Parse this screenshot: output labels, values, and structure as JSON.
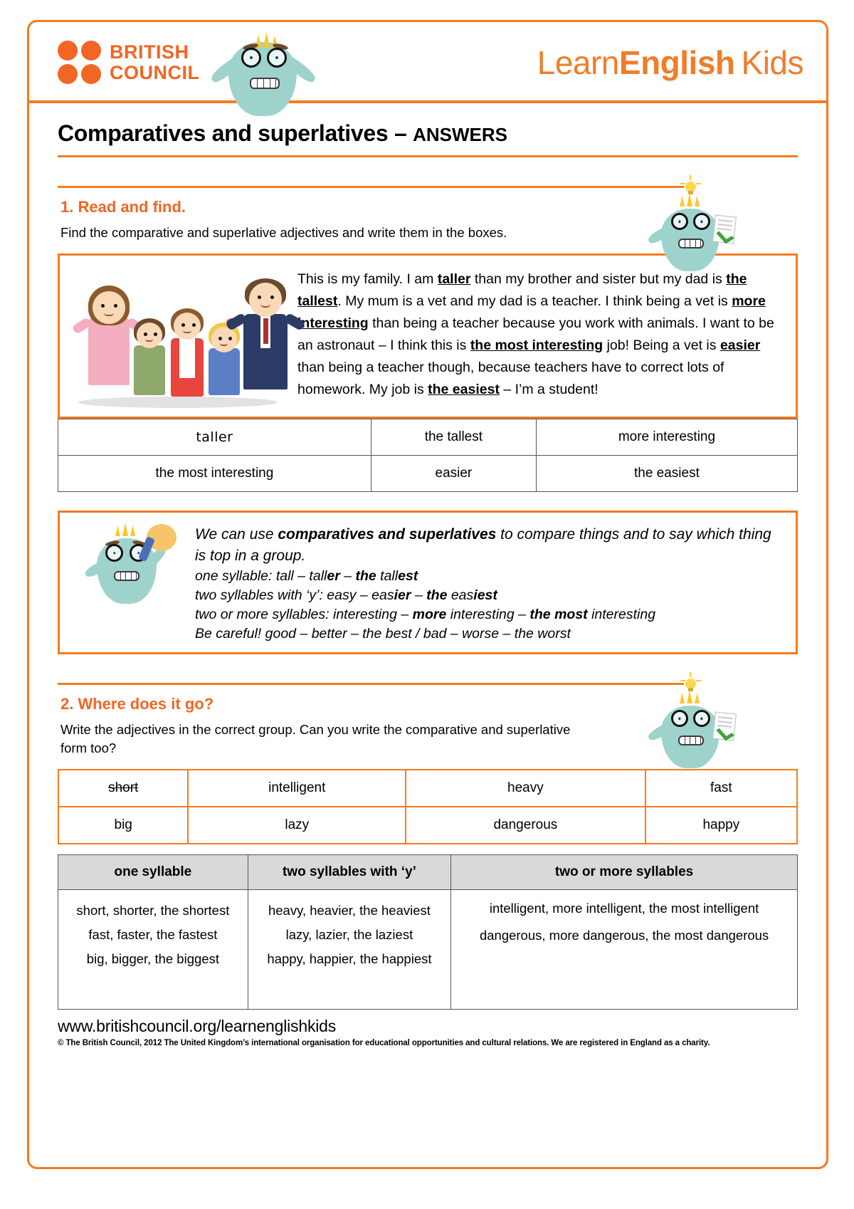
{
  "header": {
    "brand_primary": "BRITISH",
    "brand_secondary": "COUNCIL",
    "logo_learn": "Learn",
    "logo_english": "English",
    "logo_kids": "Kids",
    "accent_color": "#F47B20",
    "brand_color": "#F26522"
  },
  "title": {
    "main": "Comparatives and superlatives",
    "dash": " – ",
    "answers": "ANSWERS"
  },
  "section1": {
    "heading": "1. Read and find.",
    "instruction": "Find the comparative and superlative adjectives and write them in the boxes.",
    "passage": [
      {
        "t": "This is my family. I am ",
        "b": false
      },
      {
        "t": "taller",
        "b": true
      },
      {
        "t": " than my brother and sister but my dad is ",
        "b": false
      },
      {
        "t": "the tallest",
        "b": true
      },
      {
        "t": ". My mum is a vet and my dad is a teacher. I think being a vet is ",
        "b": false
      },
      {
        "t": "more interesting",
        "b": true
      },
      {
        "t": " than being a teacher because you work with animals. I want to be an astronaut – I think this is ",
        "b": false
      },
      {
        "t": "the most interesting",
        "b": true
      },
      {
        "t": " job! Being a vet is ",
        "b": false
      },
      {
        "t": "easier",
        "b": true
      },
      {
        "t": " than being a teacher though, because teachers have to correct lots of homework. My job is ",
        "b": false
      },
      {
        "t": "the easiest",
        "b": true
      },
      {
        "t": " – I’m a student!",
        "b": false
      }
    ],
    "answers": [
      [
        "taller",
        "the tallest",
        "more interesting"
      ],
      [
        "the most interesting",
        "easier",
        "the easiest"
      ]
    ],
    "handwritten_answer": "taller"
  },
  "tip_box": {
    "line1_a": "We can use ",
    "line1_b": "comparatives and superlatives",
    "line1_c": " to compare things and to say which thing is top in a group.",
    "line2_a": "one syllable: tall – tall",
    "line2_b": "er",
    "line2_c": " – ",
    "line2_d": "the",
    "line2_e": " tall",
    "line2_f": "est",
    "line3_a": "two syllables with ‘y’: easy – eas",
    "line3_b": "ier",
    "line3_c": " – ",
    "line3_d": "the",
    "line3_e": " eas",
    "line3_f": "iest",
    "line4_a": "two or more syllables: interesting – ",
    "line4_b": "more",
    "line4_c": " interesting – ",
    "line4_d": "the most",
    "line4_e": " interesting",
    "line5": "Be careful! good – better – the best / bad – worse – the worst"
  },
  "section2": {
    "heading": "2. Where does it go?",
    "instruction": "Write the adjectives in the correct group. Can you write the comparative and superlative form too?",
    "word_bank": [
      [
        {
          "word": "short",
          "struck": true
        },
        {
          "word": "intelligent",
          "struck": false
        },
        {
          "word": "heavy",
          "struck": false
        },
        {
          "word": "fast",
          "struck": false
        }
      ],
      [
        {
          "word": "big",
          "struck": false
        },
        {
          "word": "lazy",
          "struck": false
        },
        {
          "word": "dangerous",
          "struck": false
        },
        {
          "word": "happy",
          "struck": false
        }
      ]
    ],
    "category_headers": [
      "one syllable",
      "two syllables with ‘y’",
      "two or more syllables"
    ],
    "category_answers": {
      "one_syllable": [
        "short, shorter, the shortest",
        "fast, faster, the fastest",
        "big, bigger, the biggest"
      ],
      "two_syllables_y": [
        "heavy, heavier, the heaviest",
        "lazy, lazier, the laziest",
        "happy, happier, the happiest"
      ],
      "two_or_more": [
        "intelligent, more intelligent, the most intelligent",
        "dangerous, more dangerous, the most dangerous"
      ]
    },
    "handwritten_first_answer": "short, shorter, the shortest"
  },
  "footer": {
    "url": "www.britishcouncil.org/learnenglishkids",
    "copyright": "© The British Council, 2012 The United Kingdom’s international organisation for educational opportunities and cultural relations. We are registered in England as a charity."
  }
}
